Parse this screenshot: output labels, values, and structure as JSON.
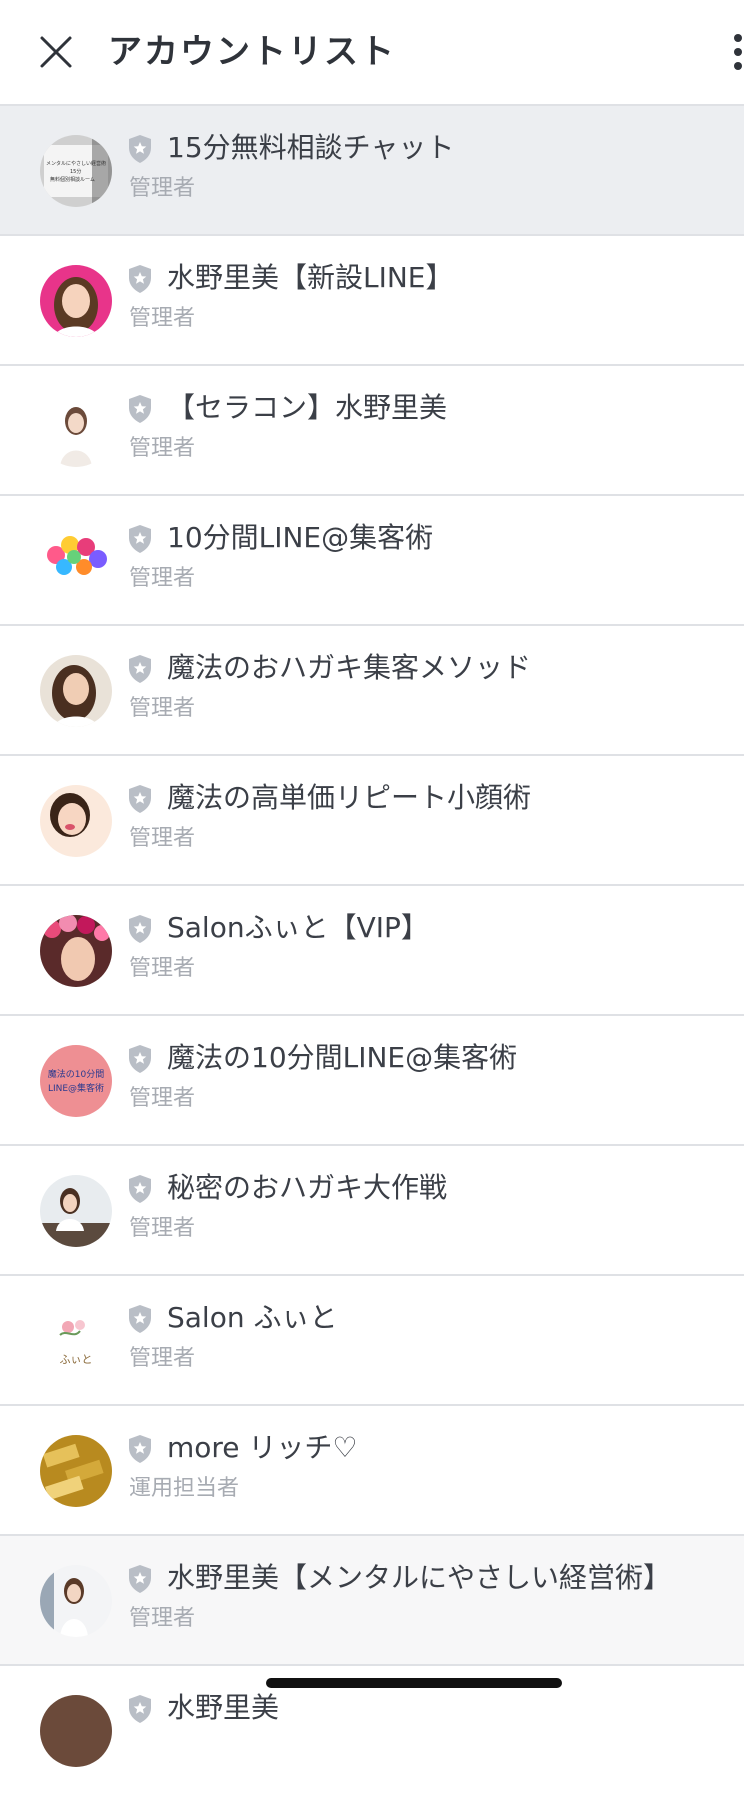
{
  "header": {
    "title": "アカウントリスト",
    "close_icon": "close-icon",
    "more_icon": "more-vertical-icon"
  },
  "accounts": [
    {
      "name": "15分無料相談チャット",
      "role": "管理者",
      "selected": true
    },
    {
      "name": "水野里美【新設LINE】",
      "role": "管理者"
    },
    {
      "name": "【セラコン】水野里美",
      "role": "管理者"
    },
    {
      "name": "10分間LINE@集客術",
      "role": "管理者"
    },
    {
      "name": "魔法のおハガキ集客メソッド",
      "role": "管理者"
    },
    {
      "name": "魔法の高単価リピート小顔術",
      "role": "管理者"
    },
    {
      "name": "Salonふぃと【VIP】",
      "role": "管理者"
    },
    {
      "name": "魔法の10分間LINE@集客術",
      "role": "管理者",
      "avatar_text": "魔法の10分間\nLINE@集客術"
    },
    {
      "name": "秘密のおハガキ大作戦",
      "role": "管理者"
    },
    {
      "name": "Salon ふぃと",
      "role": "管理者",
      "avatar_text": "ふぃと"
    },
    {
      "name": "more リッチ♡",
      "role": "運用担当者"
    },
    {
      "name": "水野里美【メンタルにやさしい経営術】",
      "role": "管理者"
    },
    {
      "name": "水野里美",
      "role": ""
    }
  ],
  "avatar_texts": {
    "first": "メンタルにやさしい経営術\n15分\n無料個別相談ルーム"
  },
  "colors": {
    "selected_row": "#eceef1",
    "divider": "#dfe1e5",
    "shield": "#b9bec6",
    "role_text": "#a7abb2"
  }
}
